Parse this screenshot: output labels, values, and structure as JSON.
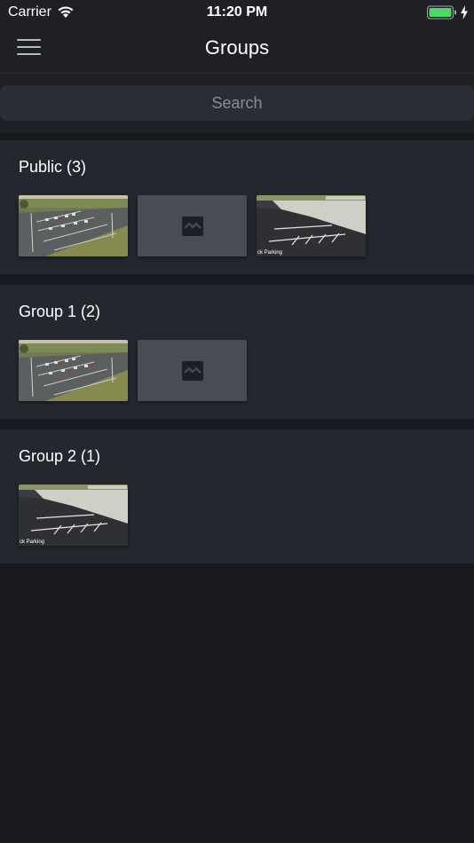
{
  "status_bar": {
    "carrier": "Carrier",
    "time": "11:20 PM",
    "battery_color": "#4cd964"
  },
  "nav": {
    "title": "Groups",
    "menu_icon": "hamburger-menu-icon"
  },
  "search": {
    "placeholder": "Search"
  },
  "groups": [
    {
      "title": "Public (3)",
      "cameras": [
        {
          "type": "parking-lot-a"
        },
        {
          "type": "placeholder",
          "icon": "image-placeholder-icon"
        },
        {
          "type": "parking-lot-b",
          "caption": "ck Parking"
        }
      ]
    },
    {
      "title": "Group 1 (2)",
      "cameras": [
        {
          "type": "parking-lot-a"
        },
        {
          "type": "placeholder",
          "icon": "image-placeholder-icon"
        }
      ]
    },
    {
      "title": "Group 2 (1)",
      "cameras": [
        {
          "type": "parking-lot-b",
          "caption": "ck Parking"
        }
      ]
    }
  ],
  "colors": {
    "background": "#18191e",
    "bar": "#1f2026",
    "group_card": "#25272e",
    "placeholder_tile": "#4a4c55"
  }
}
